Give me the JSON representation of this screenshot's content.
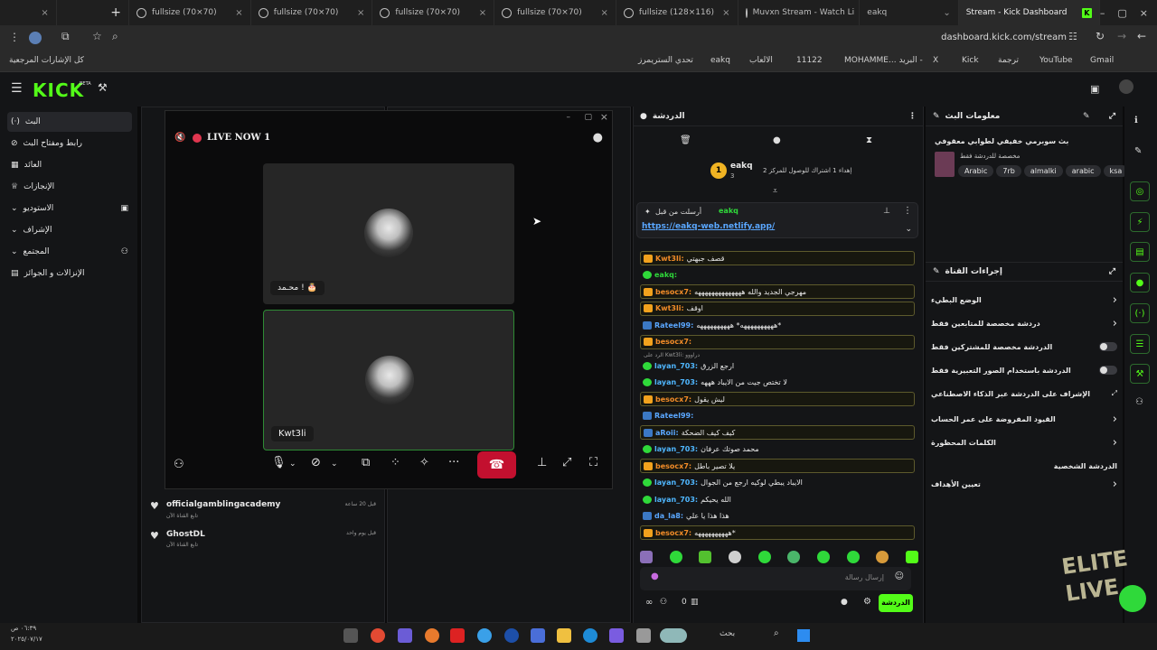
{
  "browser": {
    "tabs": [
      {
        "label": ""
      },
      {
        "label": "fullsize (70×70)"
      },
      {
        "label": "fullsize (70×70)"
      },
      {
        "label": "fullsize (70×70)"
      },
      {
        "label": "fullsize (70×70)"
      },
      {
        "label": "fullsize (128×116)"
      },
      {
        "label": "Muvxn Stream - Watch Li"
      },
      {
        "label": "eakq"
      },
      {
        "label": "Stream - Kick Dashboard"
      }
    ],
    "url": "dashboard.kick.com/stream",
    "bookmarks": [
      "كل الإشارات المرجعية",
      "تحدي الستريمرز",
      "eakq",
      "الالعاب",
      "11122",
      "MOHAMME... البريد -",
      "X",
      "Kick",
      "ترجمة",
      "YouTube",
      "Gmail"
    ]
  },
  "kick": {
    "logo": "KICK",
    "logo_badge": "BETA",
    "nav": [
      {
        "label": "البث",
        "active": true
      },
      {
        "label": "رابط ومفتاح البث"
      },
      {
        "label": "العائد"
      },
      {
        "label": "الإنجازات"
      },
      {
        "label": "الاستوديو"
      },
      {
        "label": "الإشراف"
      },
      {
        "label": "المجتمع"
      },
      {
        "label": "الإنزالات و الجوائز"
      }
    ]
  },
  "popup": {
    "live_label": "LIVE NOW 1",
    "participants": [
      "محـمد ! 🎂",
      "Kwt3li"
    ]
  },
  "activity": {
    "items": [
      {
        "name": "officialgamblingacademy",
        "sub": "تابع القناة الآن",
        "time": "قبل 20 ساعة"
      },
      {
        "name": "GhostDL",
        "sub": "تابع القناة الآن",
        "time": "قبل يوم واحد"
      }
    ]
  },
  "chat": {
    "title": "الدردشة",
    "top_user": "eakq",
    "top_user_count": "3",
    "top_note": "إهداء 1 اشتراك للوصول للمركز 2",
    "pinned_by": "أرسلت من قبل",
    "pinned_user": "eakq",
    "pinned_link": "https://eakq-web.netlify.app/",
    "messages": [
      {
        "user": "Kwt3li",
        "text": "قصف جبهتي",
        "color": "u-orange",
        "boxed": true
      },
      {
        "user": "eakq",
        "text": "",
        "color": "u-green",
        "boxed": false
      },
      {
        "user": "besocx7",
        "text": "مهرجي الجديد والله ههههههههههههههه",
        "color": "u-orange",
        "boxed": true
      },
      {
        "user": "Kwt3li",
        "text": "اوقف",
        "color": "u-orange",
        "boxed": true
      },
      {
        "user": "Rateel99",
        "text": "ههههههههههه* ههههههههههه*",
        "color": "u-blue",
        "boxed": false
      },
      {
        "user": "besocx7",
        "text": "",
        "color": "u-orange",
        "boxed": true
      },
      {
        "user": "layan_703",
        "text": "ارجع الزرق",
        "color": "u-cyan",
        "boxed": false
      },
      {
        "user": "layan_703",
        "text": "لا تختص جيت من الايباد هههه",
        "color": "u-cyan",
        "boxed": false
      },
      {
        "user": "besocx7",
        "text": "ليش يقول",
        "color": "u-orange",
        "boxed": true
      },
      {
        "user": "Rateel99",
        "text": "",
        "color": "u-blue",
        "boxed": false
      },
      {
        "user": "aRoii",
        "text": "كيف كيف الضحكة",
        "color": "u-blue",
        "boxed": true
      },
      {
        "user": "layan_703",
        "text": "محمد صوتك عرفان",
        "color": "u-cyan",
        "boxed": false
      },
      {
        "user": "besocx7",
        "text": "يلا تصير باطل",
        "color": "u-orange",
        "boxed": true
      },
      {
        "user": "layan_703",
        "text": "الايباد يبطي لوكيه ارجع من الجوال",
        "color": "u-cyan",
        "boxed": false
      },
      {
        "user": "layan_703",
        "text": "الله يحيكم",
        "color": "u-cyan",
        "boxed": false
      },
      {
        "user": "da_la8",
        "text": "هذا هذا يا علي",
        "color": "u-blue",
        "boxed": false
      },
      {
        "user": "besocx7",
        "text": "ههههههههههه*",
        "color": "u-orange",
        "boxed": true
      }
    ],
    "reply_context": "الرد على Kwt3li: دراووو",
    "input_placeholder": "إرسال رسالة",
    "send_label": "الدردشة",
    "viewer_count": "0"
  },
  "info": {
    "title": "معلومات البث",
    "stream_title": "بث سوبرمي خفيفي لطوابي معقوفي",
    "sub": "مخصصة للدردشة فقط",
    "tags": [
      "Arabic",
      "7rb",
      "almalki",
      "arabic",
      "ksa"
    ]
  },
  "actions": {
    "title": "إجراءات القناة",
    "rows": [
      {
        "label": "الوضع البطيء",
        "control": "chevron"
      },
      {
        "label": "دردشة مخصصة للمتابعين فقط",
        "control": "chevron"
      },
      {
        "label": "الدردشة مخصصة للمشتركين فقط",
        "control": "toggle"
      },
      {
        "label": "الدردشة باستخدام الصور التعبيرية فقط",
        "control": "toggle"
      },
      {
        "label": "الإشراف على الدردشة عبر الذكاء الاصطناعي",
        "control": "link"
      },
      {
        "label": "القيود المفروضة على عمر الحساب",
        "control": "chevron"
      },
      {
        "label": "الكلمات المحظورة",
        "control": "chevron"
      },
      {
        "label": "الدردشة الشخصية",
        "control": "none"
      },
      {
        "label": "تعيين الأهداف",
        "control": "chevron"
      }
    ]
  },
  "taskbar": {
    "search": "بحث",
    "time": "٠٦:٣٩ ص",
    "date": "٢٠٢٥/٠٧/١٧"
  }
}
